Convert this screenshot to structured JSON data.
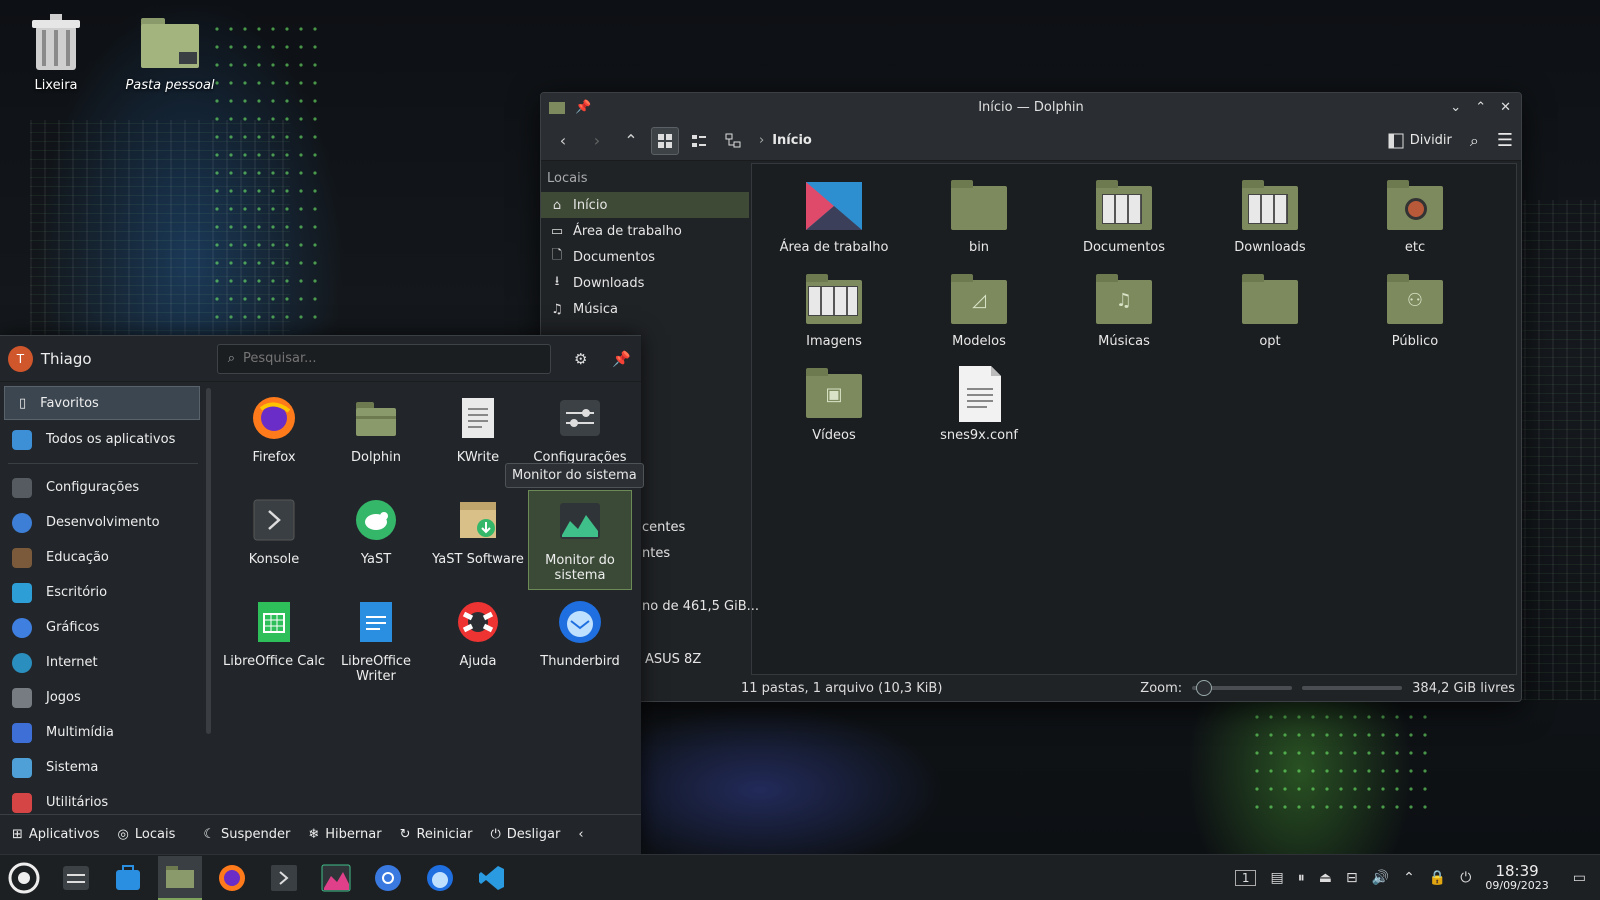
{
  "desktop": {
    "icons": [
      {
        "label": "Lixeira",
        "icon": "trash-icon"
      },
      {
        "label": "Pasta pessoal",
        "icon": "home-folder-icon"
      }
    ]
  },
  "dolphin": {
    "title": "Início — Dolphin",
    "breadcrumb": "Início",
    "split_label": "Dividir",
    "places_header": "Locais",
    "places": [
      {
        "label": "Início",
        "icon": "home-icon"
      },
      {
        "label": "Área de trabalho",
        "icon": "desktop-icon"
      },
      {
        "label": "Documentos",
        "icon": "document-icon"
      },
      {
        "label": "Downloads",
        "icon": "download-icon"
      },
      {
        "label": "Música",
        "icon": "music-icon"
      }
    ],
    "places_partial": [
      "centes",
      "ntes",
      "no de 461,5 GiB...",
      "ASUS 8Z"
    ],
    "files": [
      {
        "name": "Área de trabalho",
        "icon": "desktop-folder-icon"
      },
      {
        "name": "bin",
        "icon": "folder-icon"
      },
      {
        "name": "Documentos",
        "icon": "documents-folder-icon"
      },
      {
        "name": "Downloads",
        "icon": "downloads-folder-icon"
      },
      {
        "name": "etc",
        "icon": "folder-icon"
      },
      {
        "name": "Imagens",
        "icon": "images-folder-icon"
      },
      {
        "name": "Modelos",
        "icon": "templates-folder-icon"
      },
      {
        "name": "Músicas",
        "icon": "music-folder-icon"
      },
      {
        "name": "opt",
        "icon": "folder-icon"
      },
      {
        "name": "Público",
        "icon": "public-folder-icon"
      },
      {
        "name": "Vídeos",
        "icon": "videos-folder-icon"
      },
      {
        "name": "snes9x.conf",
        "icon": "text-file-icon"
      }
    ],
    "status": "11 pastas, 1 arquivo (10,3 KiB)",
    "zoom_label": "Zoom:",
    "free_space": "384,2 GiB livres"
  },
  "menu": {
    "user": "Thiago",
    "avatar_letter": "T",
    "search_placeholder": "Pesquisar...",
    "categories": [
      {
        "label": "Favoritos",
        "icon": "bookmark-icon",
        "color": "#3c4650"
      },
      {
        "label": "Todos os aplicativos",
        "icon": "grid-icon",
        "color": "#3d8fd6"
      },
      {
        "label": "Configurações",
        "icon": "settings-icon",
        "color": "#555b61"
      },
      {
        "label": "Desenvolvimento",
        "icon": "development-icon",
        "color": "#3d7fd6"
      },
      {
        "label": "Educação",
        "icon": "education-icon",
        "color": "#7a5a3a"
      },
      {
        "label": "Escritório",
        "icon": "office-icon",
        "color": "#2e9fd6"
      },
      {
        "label": "Gráficos",
        "icon": "graphics-icon",
        "color": "#3f7fe0"
      },
      {
        "label": "Internet",
        "icon": "internet-icon",
        "color": "#2a8fbf"
      },
      {
        "label": "Jogos",
        "icon": "games-icon",
        "color": "#777c82"
      },
      {
        "label": "Multimídia",
        "icon": "multimedia-icon",
        "color": "#3d6fd6"
      },
      {
        "label": "Sistema",
        "icon": "system-icon",
        "color": "#4fa0d6"
      },
      {
        "label": "Utilitários",
        "icon": "utilities-icon",
        "color": "#d64545"
      }
    ],
    "apps": [
      {
        "label": "Firefox",
        "icon": "firefox-icon"
      },
      {
        "label": "Dolphin",
        "icon": "dolphin-icon"
      },
      {
        "label": "KWrite",
        "icon": "kwrite-icon"
      },
      {
        "label": "Configurações",
        "icon": "system-settings-icon"
      },
      {
        "label": "Konsole",
        "icon": "konsole-icon"
      },
      {
        "label": "YaST",
        "icon": "yast-icon"
      },
      {
        "label": "YaST Software",
        "icon": "yast-software-icon"
      },
      {
        "label": "Monitor do sistema",
        "icon": "system-monitor-icon"
      },
      {
        "label": "LibreOffice Calc",
        "icon": "calc-icon"
      },
      {
        "label": "LibreOffice Writer",
        "icon": "writer-icon"
      },
      {
        "label": "Ajuda",
        "icon": "help-icon"
      },
      {
        "label": "Thunderbird",
        "icon": "thunderbird-icon"
      }
    ],
    "tooltip": "Monitor do sistema",
    "footer": {
      "apps": "Aplicativos",
      "places": "Locais",
      "suspend": "Suspender",
      "hibernate": "Hibernar",
      "restart": "Reiniciar",
      "shutdown": "Desligar"
    }
  },
  "taskbar": {
    "pager": "1",
    "time": "18:39",
    "date": "09/09/2023"
  }
}
